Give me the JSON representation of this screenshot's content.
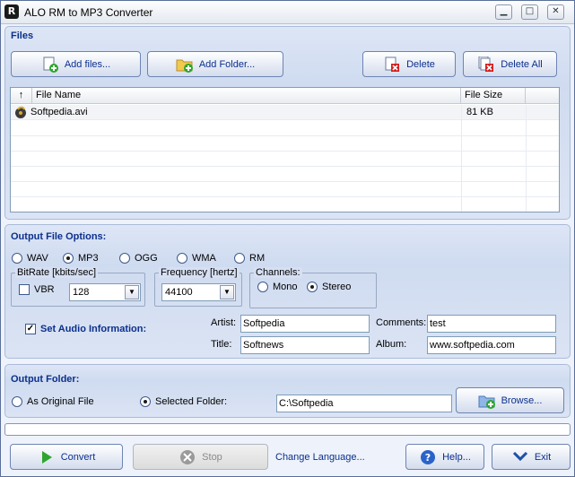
{
  "window": {
    "title": "ALO RM to MP3 Converter",
    "app_icon_letter": "R",
    "minimize": "▁",
    "maximize": "□",
    "close": "✕"
  },
  "files": {
    "section_title": "Files",
    "add_files": "Add files...",
    "add_folder": "Add Folder...",
    "delete": "Delete",
    "delete_all": "Delete All",
    "columns": {
      "sort_arrow": "↑",
      "name": "File Name",
      "size": "File Size"
    },
    "rows": [
      {
        "name": "Softpedia.avi",
        "size": "81 KB"
      }
    ]
  },
  "output_options": {
    "section_title": "Output File Options:",
    "formats": [
      "WAV",
      "MP3",
      "OGG",
      "WMA",
      "RM"
    ],
    "selected_format": "MP3",
    "bitrate_title": "BitRate [kbits/sec]",
    "vbr_label": "VBR",
    "vbr_checked": false,
    "bitrate_value": "128",
    "frequency_title": "Frequency [hertz]",
    "frequency_value": "44100",
    "channels_title": "Channels:",
    "channel_mono": "Mono",
    "channel_stereo": "Stereo",
    "selected_channel": "Stereo",
    "set_audio_label": "Set Audio Information:",
    "set_audio_checked": true,
    "artist_label": "Artist:",
    "artist_value": "Softpedia",
    "title_label": "Title:",
    "title_value": "Softnews",
    "comments_label": "Comments:",
    "comments_value": "test",
    "album_label": "Album:",
    "album_value": "www.softpedia.com"
  },
  "output_folder": {
    "section_title": "Output Folder:",
    "as_original": "As Original File",
    "selected_folder": "Selected Folder:",
    "selected_mode": "Selected Folder",
    "folder_value": "C:\\Softpedia",
    "browse": "Browse..."
  },
  "progress_percent": 0,
  "bottom": {
    "convert": "Convert",
    "stop": "Stop",
    "change_language": "Change Language...",
    "help": "Help...",
    "exit": "Exit"
  },
  "colors": {
    "accent": "#0b2f8c",
    "panel": "#d5dff2",
    "convert_icon": "#2fa52f",
    "delete_icon": "#d42020",
    "folder_icon": "#f2c94c",
    "help_icon": "#2a63c8"
  }
}
